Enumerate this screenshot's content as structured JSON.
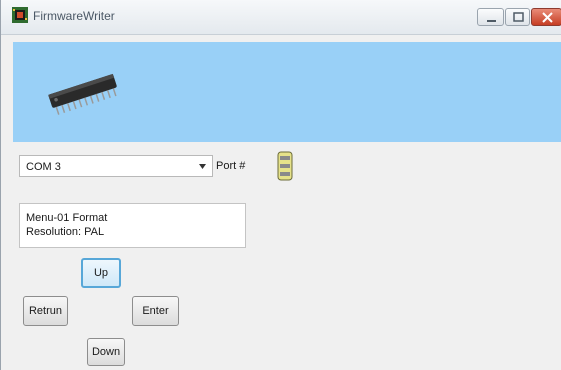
{
  "window": {
    "title": "FirmwareWriter",
    "controls": {
      "minimize": "minimize-icon",
      "maximize": "maximize-icon",
      "close": "close-icon"
    }
  },
  "banner": {
    "color": "#99d0f7",
    "image": "ic-chip-icon"
  },
  "port": {
    "selected": "COM 3",
    "label": "Port #",
    "icon": "serial-port-icon"
  },
  "status": {
    "line1": "Menu-01 Format",
    "line2": "Resolution: PAL"
  },
  "buttons": {
    "up": "Up",
    "return": "Retrun",
    "enter": "Enter",
    "down": "Down"
  },
  "colors": {
    "focus_border": "#57a7d8",
    "close_button": "#c63e24"
  }
}
